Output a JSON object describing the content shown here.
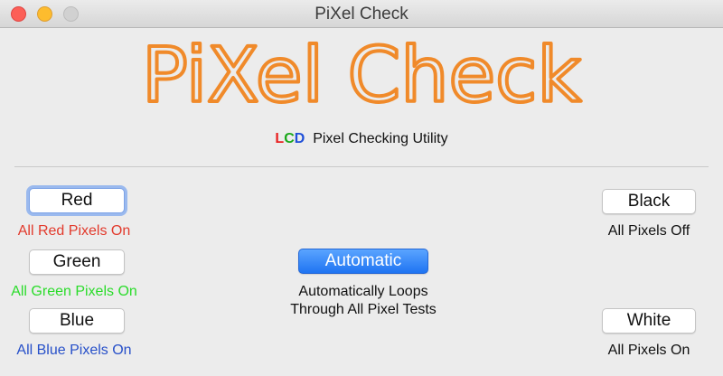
{
  "window": {
    "title": "PiXel Check"
  },
  "header": {
    "logo_text": "PiXel Check",
    "logo_color": "#f08a2a",
    "subtitle_l": "L",
    "subtitle_c": "C",
    "subtitle_d": "D",
    "subtitle_rest": "Pixel Checking Utility"
  },
  "buttons": {
    "red": {
      "label": "Red",
      "caption": "All Red Pixels On",
      "caption_color": "#e23a2c"
    },
    "green": {
      "label": "Green",
      "caption": "All Green Pixels On",
      "caption_color": "#2adc2a"
    },
    "blue": {
      "label": "Blue",
      "caption": "All Blue Pixels On",
      "caption_color": "#2750c9"
    },
    "black": {
      "label": "Black",
      "caption": "All Pixels Off"
    },
    "white": {
      "label": "White",
      "caption": "All Pixels On"
    },
    "automatic": {
      "label": "Automatic",
      "caption_line1": "Automatically Loops",
      "caption_line2": "Through All Pixel Tests"
    }
  }
}
